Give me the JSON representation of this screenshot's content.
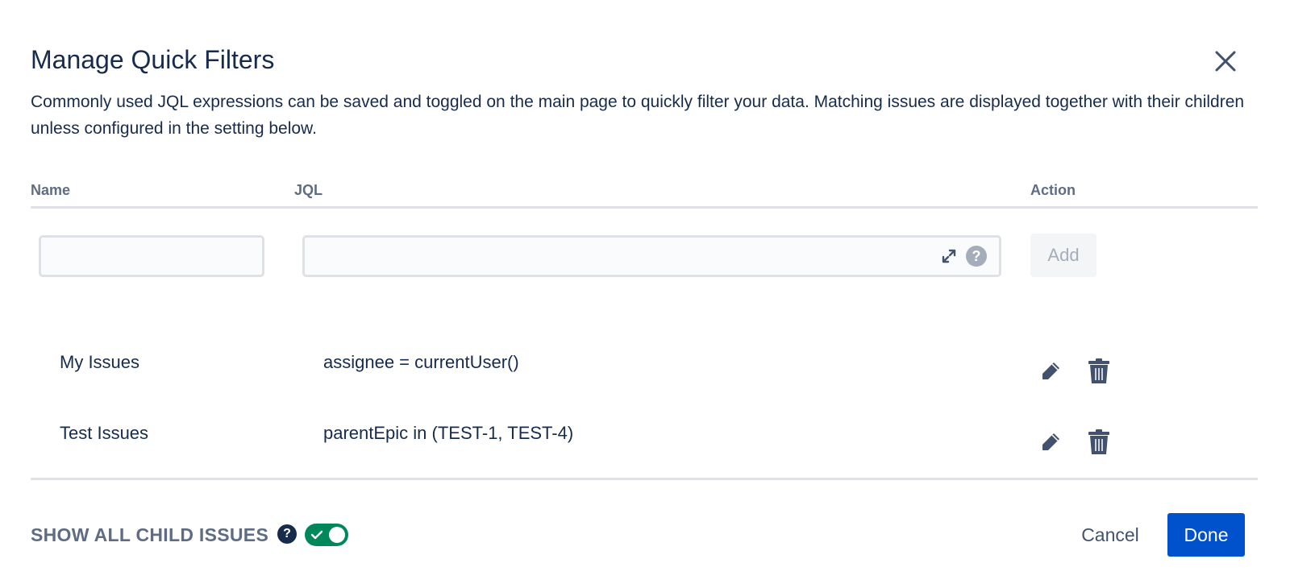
{
  "dialog": {
    "title": "Manage Quick Filters",
    "description": "Commonly used JQL expressions can be saved and toggled on the main page to quickly filter your data. Matching issues are displayed together with their children unless configured in the setting below."
  },
  "table": {
    "headers": {
      "name": "Name",
      "jql": "JQL",
      "action": "Action"
    },
    "new_filter": {
      "name_value": "",
      "jql_value": "",
      "add_label": "Add"
    },
    "rows": [
      {
        "name": "My Issues",
        "jql": "assignee = currentUser()"
      },
      {
        "name": "Test Issues",
        "jql": "parentEpic in (TEST-1, TEST-4)"
      }
    ]
  },
  "footer": {
    "show_child_label": "SHOW ALL CHILD ISSUES",
    "show_child_enabled": true,
    "cancel_label": "Cancel",
    "done_label": "Done"
  },
  "icons": {
    "close": "close-icon",
    "expand": "expand-icon",
    "help": "help-icon",
    "edit": "pencil-icon",
    "delete": "trash-icon",
    "check": "check-icon"
  },
  "colors": {
    "primary": "#0052cc",
    "toggle_on": "#00875a",
    "text": "#172b4d",
    "subtle_text": "#5e6c84",
    "icon": "#42526e",
    "disabled_text": "#a5adba"
  }
}
